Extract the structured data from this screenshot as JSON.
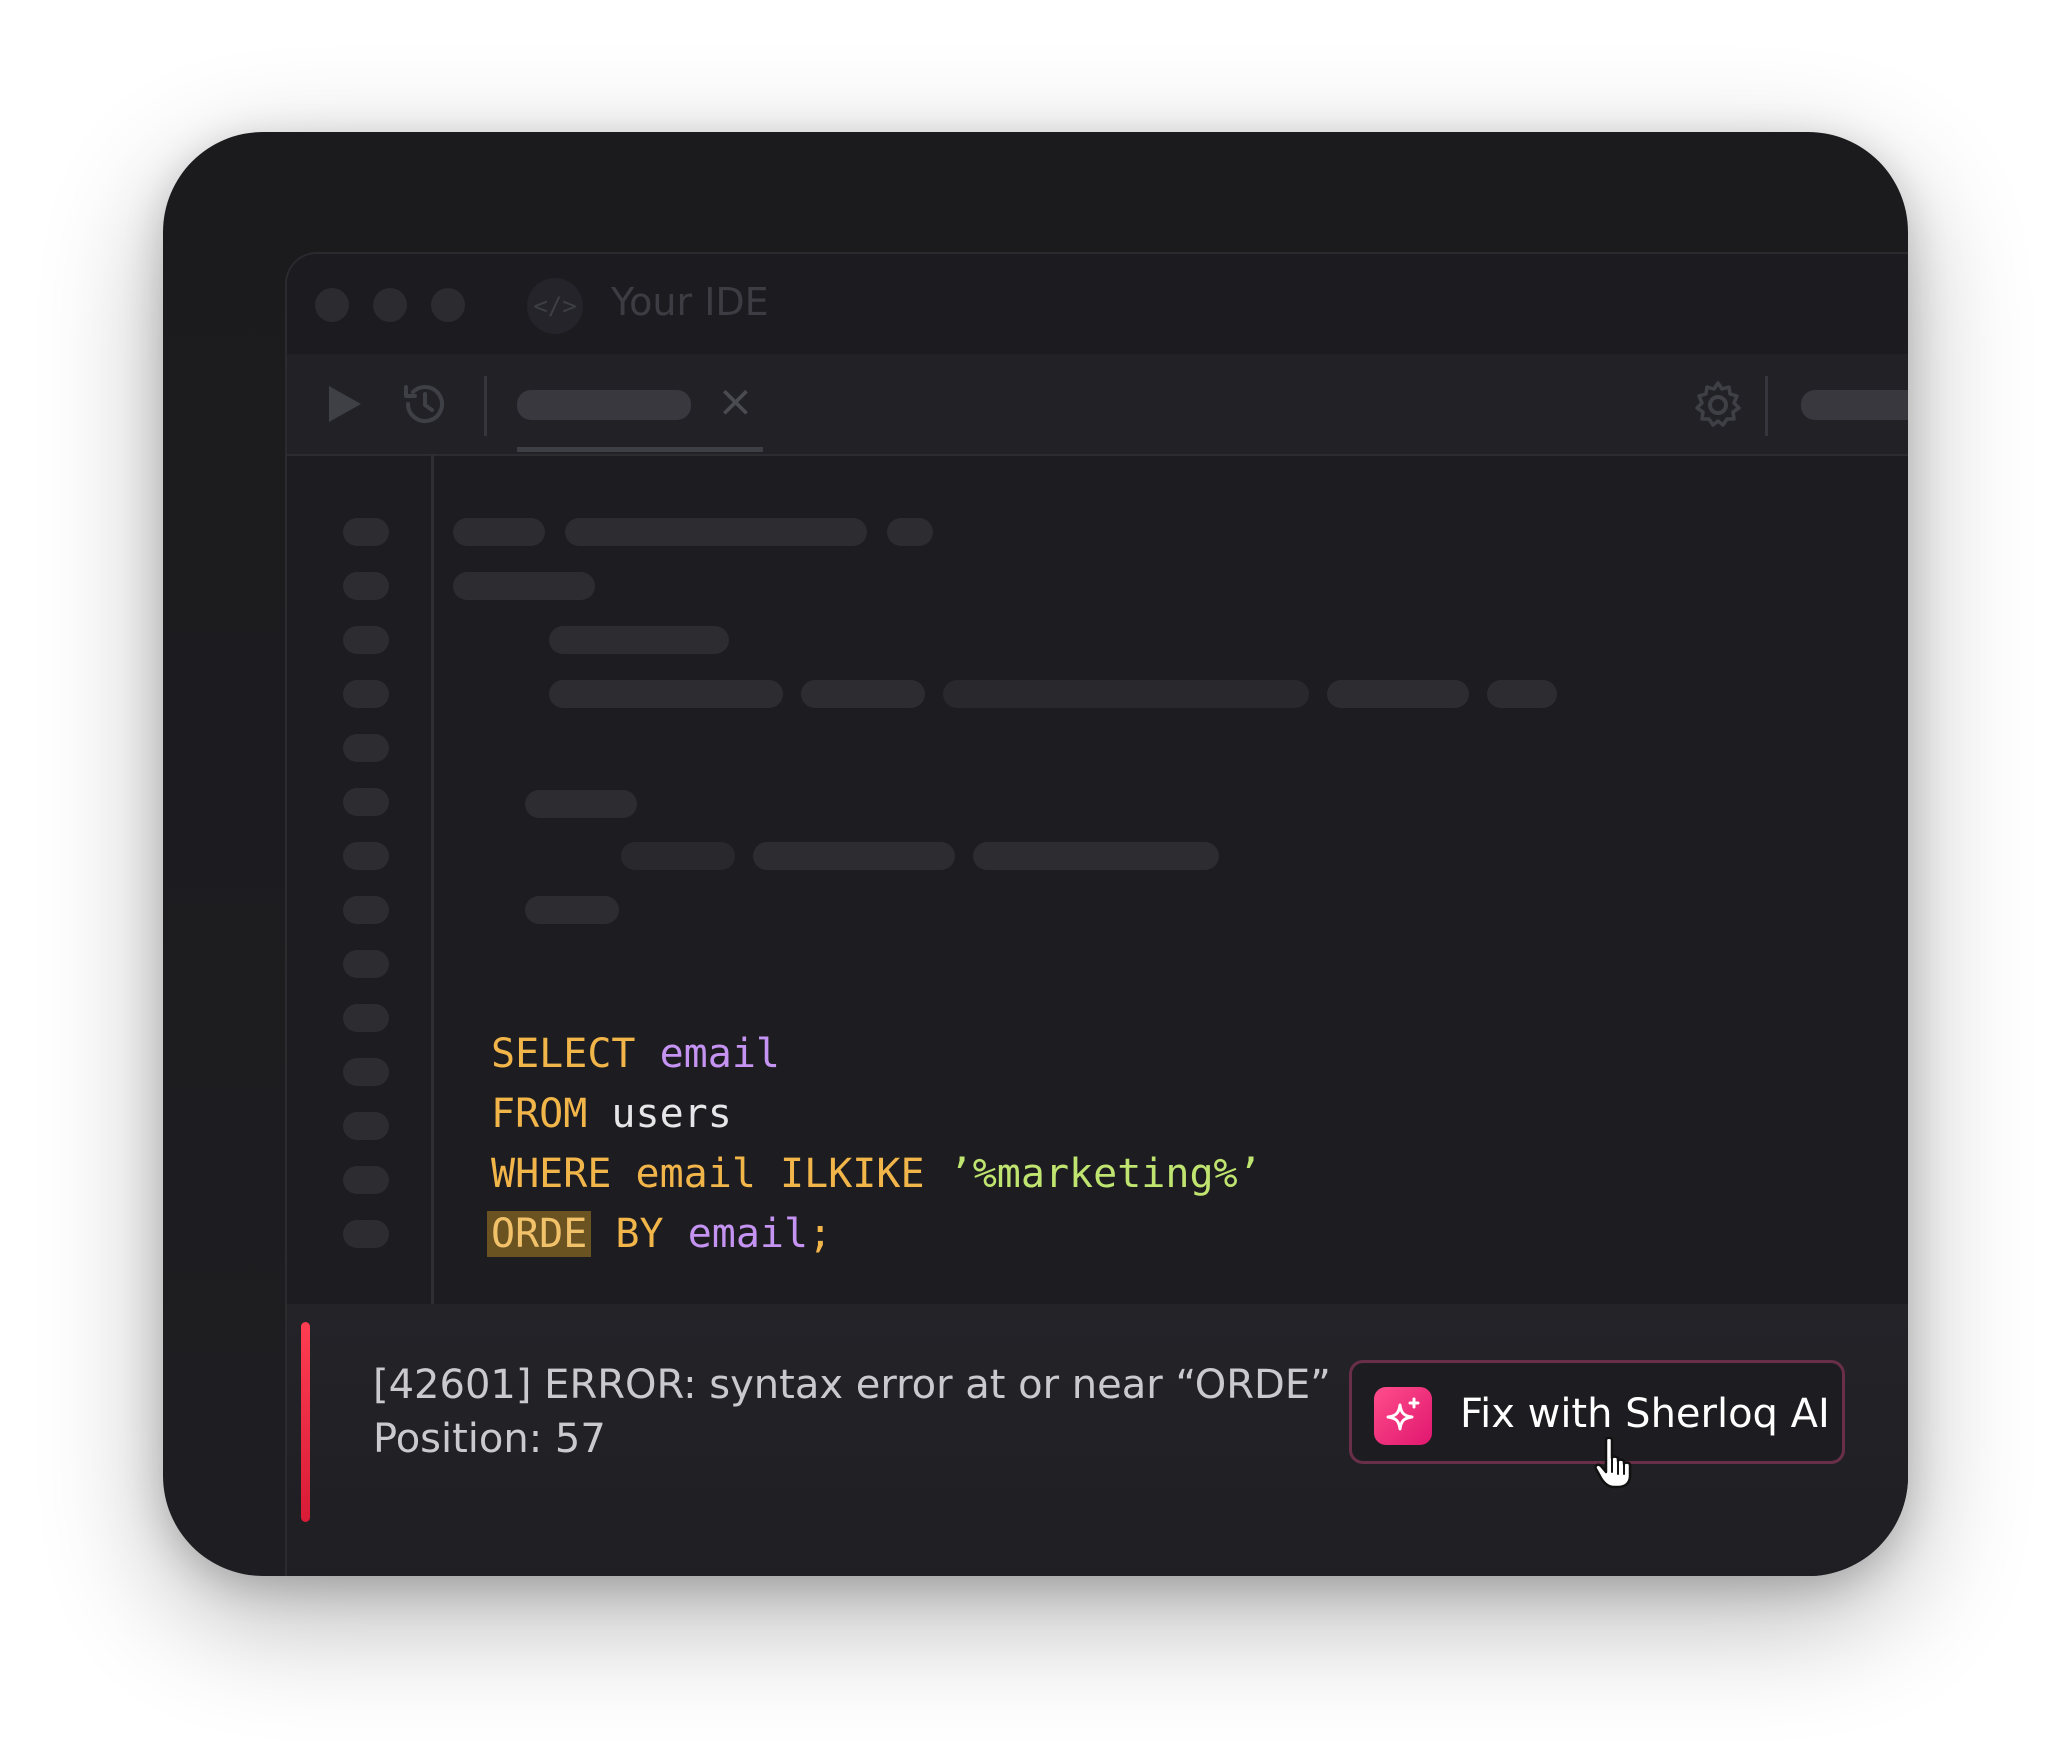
{
  "window": {
    "title": "Your IDE",
    "app_icon_glyph": "</>"
  },
  "toolbar": {
    "tab_close_glyph": "×",
    "icons": [
      "play-icon",
      "history-icon",
      "gear-icon"
    ]
  },
  "editor": {
    "line_count": 14,
    "lines": [
      [
        {
          "t": "SELECT",
          "c": "kw"
        },
        {
          "t": " ",
          "c": "pl"
        },
        {
          "t": "email",
          "c": "id"
        }
      ],
      [
        {
          "t": "FROM",
          "c": "kw"
        },
        {
          "t": " users",
          "c": "pl"
        }
      ],
      [
        {
          "t": "WHERE",
          "c": "kw"
        },
        {
          "t": " ",
          "c": "pl"
        },
        {
          "t": "email",
          "c": "kw"
        },
        {
          "t": " ",
          "c": "pl"
        },
        {
          "t": "ILKIKE",
          "c": "kw"
        },
        {
          "t": " ",
          "c": "pl"
        },
        {
          "t": "’%marketing%’",
          "c": "str"
        }
      ],
      [
        {
          "t": "ORDE",
          "c": "hl"
        },
        {
          "t": " ",
          "c": "pl"
        },
        {
          "t": "BY",
          "c": "kw"
        },
        {
          "t": " ",
          "c": "pl"
        },
        {
          "t": "email",
          "c": "id"
        },
        {
          "t": ";",
          "c": "kw"
        }
      ]
    ]
  },
  "error": {
    "message": "[42601] ERROR: syntax error at or near “ORDE”",
    "position": "Position: 57"
  },
  "fix_button": {
    "label": "Fix with Sherloq AI",
    "icon": "sparkle-icon"
  },
  "colors": {
    "keyword": "#f2b54a",
    "identifier": "#c593f2",
    "string": "#bfe46f",
    "error_accent": "#ff3d52",
    "brand_pink": "#e0176f"
  }
}
